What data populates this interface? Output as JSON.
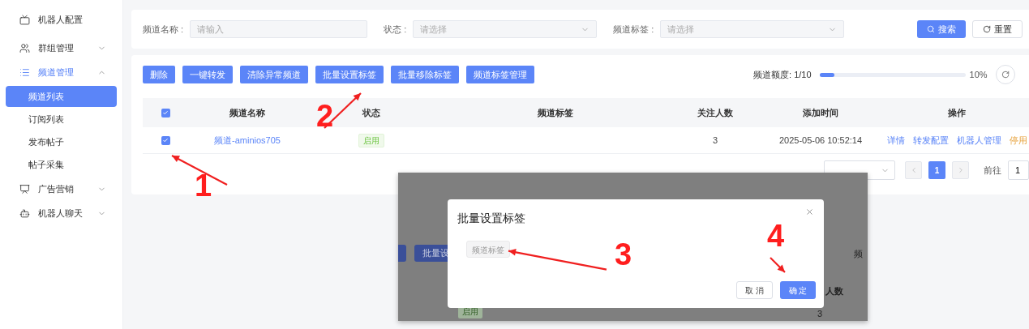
{
  "sidebar": {
    "items": [
      {
        "label": "机器人配置"
      },
      {
        "label": "群组管理",
        "expanded": false
      },
      {
        "label": "频道管理",
        "expanded": true,
        "children": [
          {
            "label": "频道列表",
            "selected": true
          },
          {
            "label": "订阅列表",
            "selected": false
          },
          {
            "label": "发布帖子",
            "selected": false
          },
          {
            "label": "帖子采集",
            "selected": false
          }
        ]
      },
      {
        "label": "广告营销",
        "expanded": false
      },
      {
        "label": "机器人聊天",
        "expanded": false
      }
    ]
  },
  "filters": [
    {
      "kind": "input",
      "label": "频道名称 :",
      "placeholder": "请输入"
    },
    {
      "kind": "select",
      "label": "状态 :",
      "placeholder": "请选择"
    },
    {
      "kind": "select",
      "label": "频道标签 :",
      "placeholder": "请选择"
    }
  ],
  "search_button": "搜索",
  "reset_button": "重置",
  "toolbar": [
    "删除",
    "一键转发",
    "清除异常频道",
    "批量设置标签",
    "批量移除标签",
    "频道标签管理"
  ],
  "quota": {
    "label": "频道额度:",
    "value": "1/10",
    "level": 0.1,
    "percent": "10%"
  },
  "table": {
    "select_all": true,
    "columns": [
      "频道名称",
      "状态",
      "频道标签",
      "关注人数",
      "添加时间",
      "操作"
    ],
    "rows": [
      {
        "selected": true,
        "name": "频道-aminios705",
        "status": "启用",
        "followers": "3",
        "added": "2025-05-06 10:52:14",
        "actions": [
          {
            "label": "详情",
            "kind": "link"
          },
          {
            "label": "转发配置",
            "kind": "link"
          },
          {
            "label": "机器人管理",
            "kind": "link"
          },
          {
            "label": "停用",
            "kind": "warning"
          }
        ]
      }
    ]
  },
  "pagination": {
    "pages": [
      {
        "label": "1",
        "selected": true
      }
    ],
    "goto_label": "前往",
    "goto_value": "1"
  },
  "inset": {
    "dialog": {
      "title": "批量设置标签",
      "tag": "频道标签",
      "cancel": "取 消",
      "confirm": "确 定"
    },
    "behind": {
      "button": "批量设",
      "column_head": "频",
      "count_head": "人数",
      "count": "3",
      "status": "启用"
    }
  },
  "annotations": [
    "1",
    "2",
    "3",
    "4"
  ]
}
